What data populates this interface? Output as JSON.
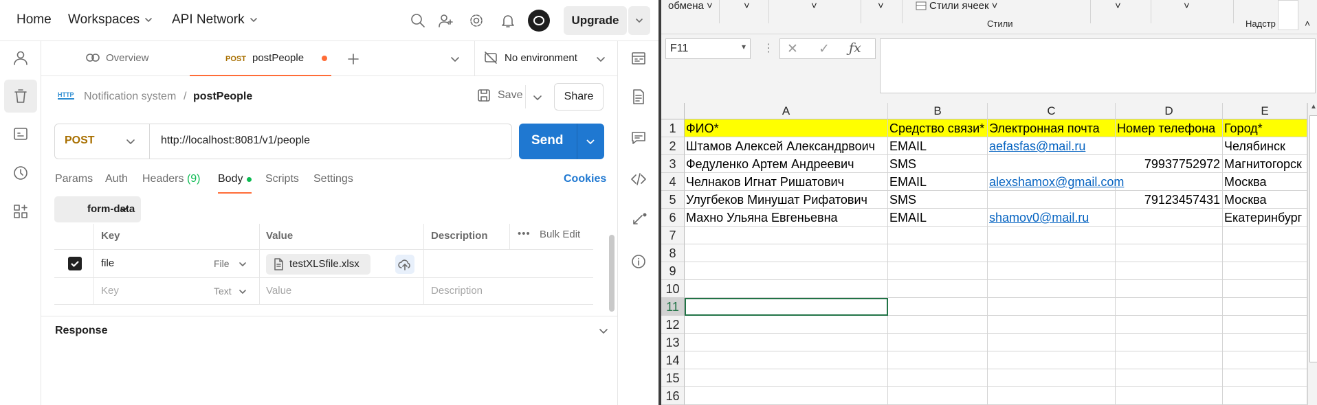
{
  "postman": {
    "nav": {
      "home": "Home",
      "workspaces": "Workspaces",
      "api_network": "API Network",
      "upgrade": "Upgrade"
    },
    "tabs": {
      "overview": "Overview",
      "method_badge": "POST",
      "active": "postPeople",
      "environment": "No environment"
    },
    "breadcrumb": {
      "collection": "Notification system",
      "separator": "/",
      "request": "postPeople",
      "protocol_badge": "HTTP"
    },
    "actions": {
      "save": "Save",
      "share": "Share"
    },
    "request": {
      "method": "POST",
      "url": "http://localhost:8081/v1/people",
      "send": "Send"
    },
    "subtabs": {
      "params": "Params",
      "auth": "Auth",
      "headers": "Headers",
      "headers_count": "(9)",
      "body": "Body",
      "scripts": "Scripts",
      "settings": "Settings",
      "cookies": "Cookies"
    },
    "body_mode": "form-data",
    "table": {
      "headers": {
        "key": "Key",
        "value": "Value",
        "description": "Description",
        "bulk_edit": "Bulk Edit"
      },
      "row": {
        "key": "file",
        "type": "File",
        "value": "testXLSfile.xlsx"
      },
      "placeholder": {
        "key": "Key",
        "type": "Text",
        "value": "Value",
        "description": "Description"
      }
    },
    "response": "Response",
    "colors": {
      "send": "#1f78d1",
      "method": "#a86f00",
      "accent": "#ff6c37",
      "active_dot": "#0cbb52"
    }
  },
  "excel": {
    "ribbon": {
      "clipboard_label": "обмена",
      "cell_styles": "Стили ячеек",
      "styles_group": "Стили",
      "addins": "Надстр"
    },
    "name_box": "F11",
    "columns": [
      "A",
      "B",
      "C",
      "D",
      "E"
    ],
    "rows": [
      [
        "ФИО*",
        "Средство связи*",
        "Электронная почта",
        "Номер телефона",
        "Город*"
      ],
      [
        "Штамов Алексей Александрвоич",
        "EMAIL",
        "aefasfas@mail.ru",
        "",
        "Челябинск"
      ],
      [
        "Федуленко Артем Андреевич",
        "SMS",
        "",
        "79937752972",
        "Магнитогорск"
      ],
      [
        "Челнаков Игнат Ришатович",
        "EMAIL",
        "alexshamox@gmail.com",
        "",
        "Москва"
      ],
      [
        "Улугбеков Минушат Рифатович",
        "SMS",
        "",
        "79123457431",
        "Москва"
      ],
      [
        "Махно Ульяна Евгеньевна",
        "EMAIL",
        "shamov0@mail.ru",
        "",
        "Екатеринбург"
      ]
    ],
    "row_numbers": [
      "1",
      "2",
      "3",
      "4",
      "5",
      "6",
      "7",
      "8",
      "9",
      "10",
      "11",
      "12",
      "13",
      "14",
      "15",
      "16"
    ],
    "colors": {
      "header_fill": "#ffff00",
      "link": "#0563c1"
    }
  }
}
